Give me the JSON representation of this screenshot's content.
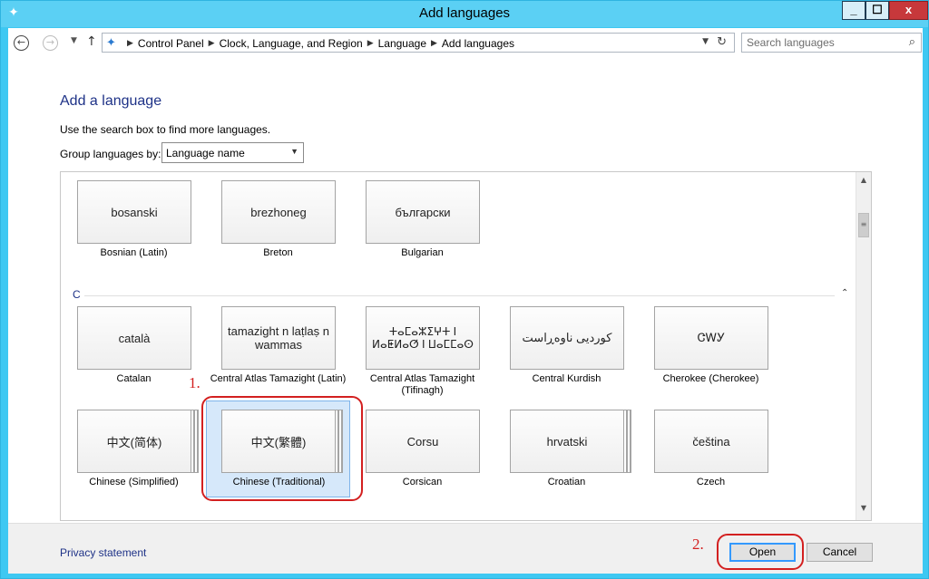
{
  "window": {
    "title": "Add languages",
    "controls": {
      "minimize": "_",
      "maximize": "☐",
      "close": "x"
    }
  },
  "address_bar": {
    "breadcrumbs": [
      "Control Panel",
      "Clock, Language, and Region",
      "Language",
      "Add languages"
    ],
    "search_placeholder": "Search languages"
  },
  "content": {
    "heading": "Add a language",
    "hint": "Use the search box to find more languages.",
    "group_label": "Group languages by:",
    "group_value": "Language name",
    "section_c": "C"
  },
  "languages_top": [
    {
      "native": "bosanski",
      "english": "Bosnian (Latin)"
    },
    {
      "native": "brezhoneg",
      "english": "Breton"
    },
    {
      "native": "български",
      "english": "Bulgarian"
    }
  ],
  "languages_c_row1": [
    {
      "native": "català",
      "english": "Catalan"
    },
    {
      "native": "tamazight n laṭlaṣ n wammas",
      "english": "Central Atlas Tamazight (Latin)"
    },
    {
      "native": "ⵜⴰⵎⴰⵣⵉⵖⵜ ⵏ ⵍⴰⵟⵍⴰⵚ ⵏ ⵡⴰⵎⵎⴰⵙ",
      "english": "Central Atlas Tamazight (Tifinagh)"
    },
    {
      "native": "کوردیی ناوەڕاست",
      "english": "Central Kurdish"
    },
    {
      "native": "ᏣᎳᎩ",
      "english": "Cherokee (Cherokee)"
    }
  ],
  "languages_c_row2": [
    {
      "native": "中文(简体)",
      "english": "Chinese (Simplified)"
    },
    {
      "native": "中文(繁體)",
      "english": "Chinese (Traditional)"
    },
    {
      "native": "Corsu",
      "english": "Corsican"
    },
    {
      "native": "hrvatski",
      "english": "Croatian"
    },
    {
      "native": "čeština",
      "english": "Czech"
    }
  ],
  "annotations": {
    "step1": "1.",
    "step2": "2."
  },
  "footer": {
    "privacy": "Privacy statement",
    "open": "Open",
    "cancel": "Cancel"
  }
}
